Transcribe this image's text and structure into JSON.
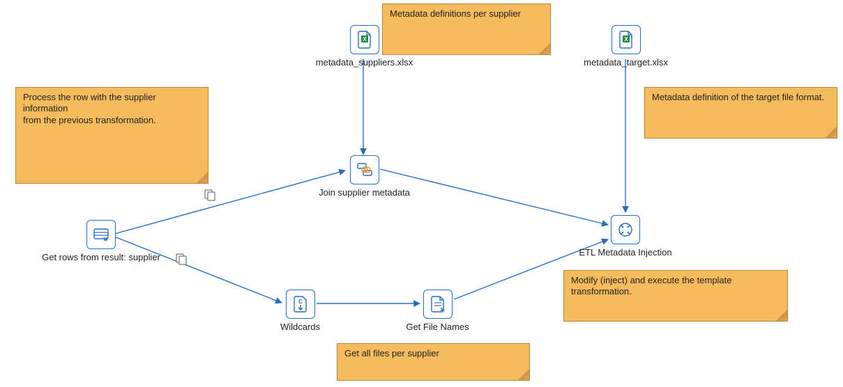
{
  "steps": {
    "metadata_suppliers": {
      "label": "metadata_suppliers.xlsx"
    },
    "metadata_target": {
      "label": "metadata_target.xlsx"
    },
    "get_rows": {
      "label": "Get rows from result: supplier"
    },
    "join_supplier": {
      "label": "Join supplier metadata"
    },
    "wildcards": {
      "label": "Wildcards"
    },
    "get_file_names": {
      "label": "Get File Names"
    },
    "etl_injection": {
      "label": "ETL Metadata Injection"
    }
  },
  "notes": {
    "n1": "Metadata definitions per supplier",
    "n2": "Process the row with the supplier information\nfrom the previous transformation.",
    "n3": "Metadata definition of the target file format.",
    "n4": "Modify (inject) and execute the template transformation.",
    "n5": "Get all files per supplier"
  },
  "colors": {
    "note_bg": "#f6bb5c",
    "note_border": "#b8853a",
    "arrow": "#2a6dbb",
    "icon_border": "#2a6dbb"
  }
}
